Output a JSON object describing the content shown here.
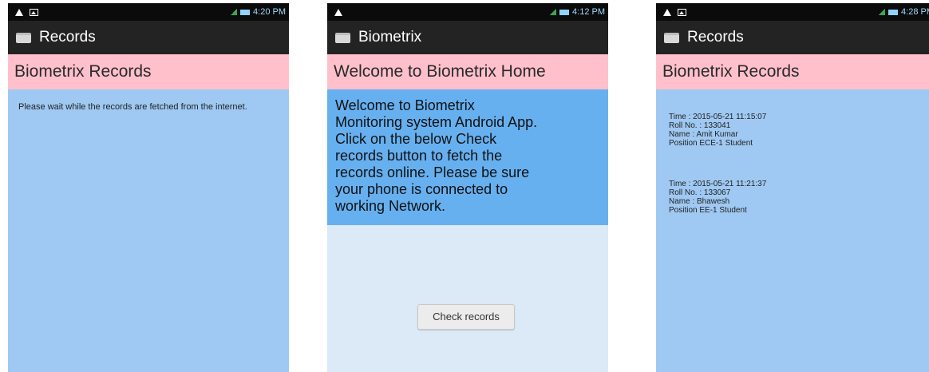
{
  "screens": [
    {
      "status": {
        "time": "4:20 PM"
      },
      "action_bar_title": "Records",
      "page_header": "Biometrix Records",
      "message": "Please wait while the records are fetched from the internet."
    },
    {
      "status": {
        "time": "4:12 PM"
      },
      "action_bar_title": "Biometrix",
      "page_header": "Welcome to Biometrix Home",
      "welcome_lines": [
        "Welcome to Biometrix",
        "Monitoring system Android App.",
        "Click on the below Check",
        "records button to fetch the",
        "records online. Please be sure",
        "your phone is connected to",
        "working Network."
      ],
      "button_label": "Check records"
    },
    {
      "status": {
        "time": "4:28 PM"
      },
      "action_bar_title": "Records",
      "page_header": "Biometrix Records",
      "records": [
        {
          "time": "Time : 2015-05-21 11:15:07",
          "roll": "Roll No. : 133041",
          "name": "Name : Amit Kumar",
          "position": "Position ECE-1 Student"
        },
        {
          "time": "Time : 2015-05-21 11:21:37",
          "roll": "Roll No. : 133067",
          "name": "Name : Bhawesh",
          "position": "Position EE-1 Student"
        }
      ]
    }
  ],
  "icons": {
    "status_left": [
      "warning-icon",
      "image-icon"
    ],
    "status_right": [
      "signal-icon",
      "battery-icon"
    ],
    "app": "app-icon"
  },
  "colors": {
    "status_bar": "#0b0b0b",
    "action_bar": "#232323",
    "header": "#ffc0cb",
    "content": "#9fc9f3",
    "welcome": "#66b0f0",
    "home_background": "#dce9f6"
  }
}
